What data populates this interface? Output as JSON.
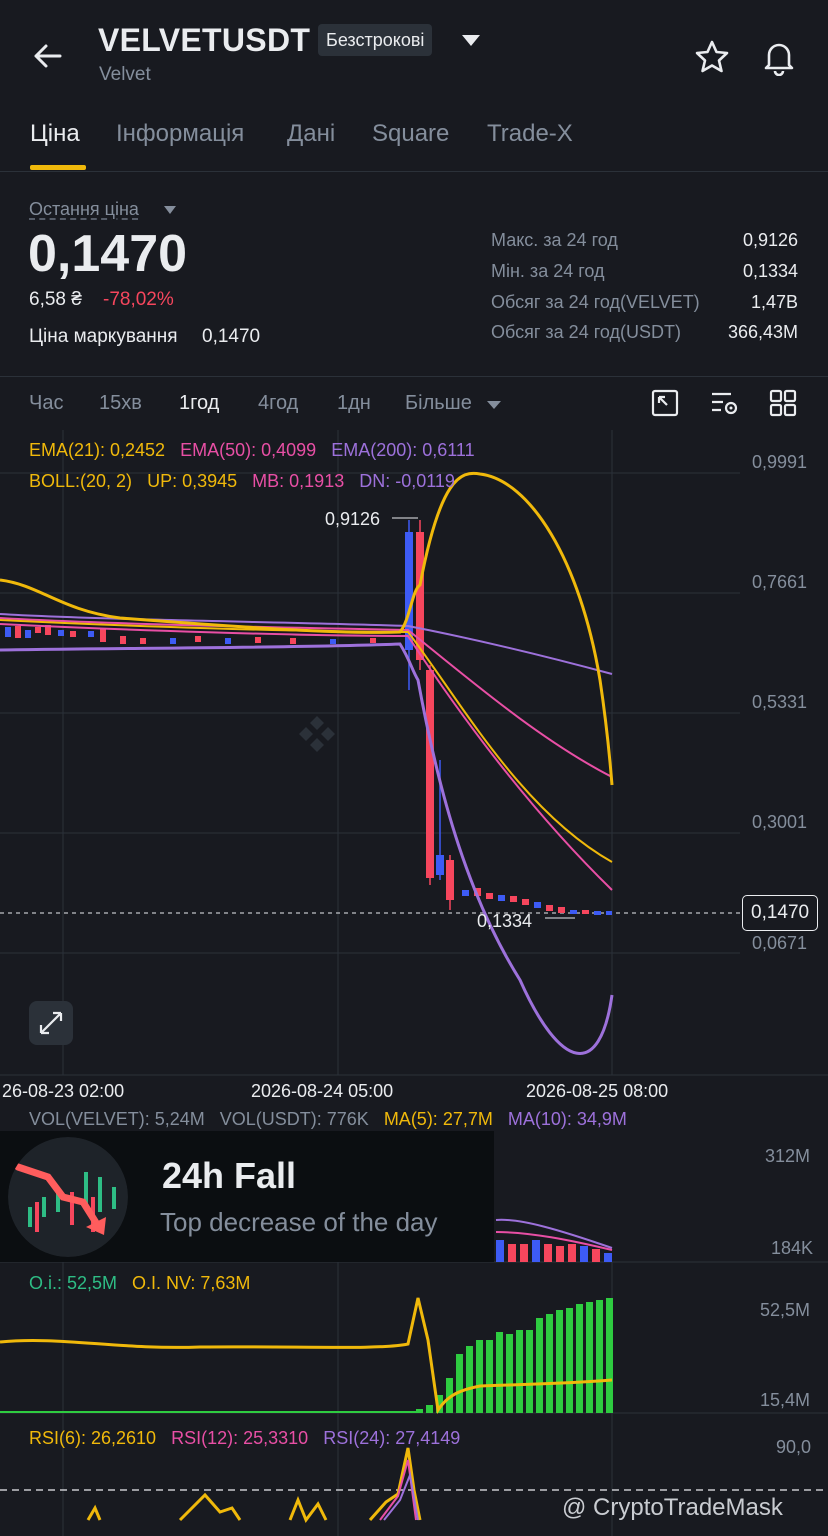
{
  "header": {
    "title": "VELVETUSDT",
    "contract_type": "Безстрокові",
    "subtitle": "Velvet"
  },
  "tabs": [
    {
      "label": "Ціна",
      "active": true
    },
    {
      "label": "Інформація",
      "active": false
    },
    {
      "label": "Дані",
      "active": false
    },
    {
      "label": "Square",
      "active": false
    },
    {
      "label": "Trade-X",
      "active": false
    }
  ],
  "summary": {
    "last_price_label": "Остання ціна",
    "last_price": "0,1470",
    "fiat_price": "6,58 ₴",
    "change_pct": "-78,02%",
    "mark_label": "Ціна маркування",
    "mark_price": "0,1470"
  },
  "stats": [
    {
      "label": "Макс. за 24 год",
      "value": "0,9126"
    },
    {
      "label": "Мін. за 24 год",
      "value": "0,1334"
    },
    {
      "label": "Обсяг за 24 год(VELVET)",
      "value": "1,47B"
    },
    {
      "label": "Обсяг за 24 год(USDT)",
      "value": "366,43M"
    }
  ],
  "intervals": [
    {
      "label": "Час",
      "active": false
    },
    {
      "label": "15хв",
      "active": false
    },
    {
      "label": "1год",
      "active": true
    },
    {
      "label": "4год",
      "active": false
    },
    {
      "label": "1дн",
      "active": false
    },
    {
      "label": "Більше",
      "active": false
    }
  ],
  "indicators": {
    "ema21": "EMA(21): 0,2452",
    "ema50": "EMA(50): 0,4099",
    "ema200": "EMA(200): 0,6111",
    "boll": "BOLL:(20, 2)",
    "boll_up": "UP: 0,3945",
    "boll_mb": "MB: 0,1913",
    "boll_dn": "DN: -0,0119"
  },
  "price_axis": [
    "0,9991",
    "0,7661",
    "0,5331",
    "0,3001",
    "0,0671"
  ],
  "current_price_tag": "0,1470",
  "high_callout": "0,9126",
  "low_callout": "0,1334",
  "time_axis": [
    "26-08-23 02:00",
    "2026-08-24 05:00",
    "2026-08-25 08:00"
  ],
  "volume": {
    "vol_velvet": "VOL(VELVET): 5,24M",
    "vol_usdt": "VOL(USDT): 776K",
    "ma5": "MA(5): 27,7M",
    "ma10": "MA(10): 34,9M",
    "axis": [
      "312M",
      "184K"
    ]
  },
  "banner": {
    "title": "24h Fall",
    "subtitle": "Top decrease of the day"
  },
  "open_interest": {
    "oi": "O.i.: 52,5M",
    "oi_nv": "O.I. NV: 7,63M",
    "axis": [
      "52,5M",
      "15,4M"
    ]
  },
  "rsi": {
    "rsi6": "RSI(6): 26,2610",
    "rsi12": "RSI(12): 25,3310",
    "rsi24": "RSI(24): 27,4149",
    "axis": [
      "90,0"
    ]
  },
  "watermark": "@ CryptoTradeMask",
  "colors": {
    "background": "#181a20",
    "accent": "#f0b90b",
    "down": "#f6465d",
    "up_candle": "#3d5bf5",
    "oi_bars": "#2ecc40"
  }
}
